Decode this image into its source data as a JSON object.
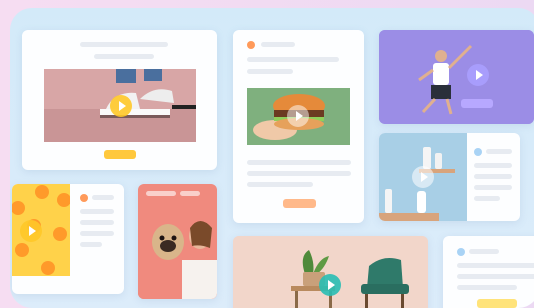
{
  "colors": {
    "page_background": "#f3dcf2",
    "board_background": "#d6ebf9",
    "card_background": "#fdfeff",
    "placeholder_bar": "#e7ebf1",
    "yellow_button": "#ffc83d",
    "peach_button": "#ffb98a",
    "lavender_button": "#b7a8ff",
    "orange_dot": "#ff9a5a",
    "blue_dot": "#a9d3f5"
  },
  "cards": [
    {
      "name": "sneakers-card",
      "image": "sneakers-photo",
      "play_icon": "play-icon"
    },
    {
      "name": "burger-card",
      "image": "burger-photo",
      "play_icon": "play-icon"
    },
    {
      "name": "jumping-man-card",
      "image": "jumping-man-photo",
      "play_icon": "play-icon"
    },
    {
      "name": "skincare-card",
      "image": "skincare-bottles-photo",
      "play_icon": "play-icon"
    },
    {
      "name": "oranges-card",
      "image": "oranges-photo",
      "play_icon": "play-icon"
    },
    {
      "name": "pug-card",
      "image": "woman-with-pug-photo"
    },
    {
      "name": "furniture-card",
      "image": "armchair-and-plant-photo",
      "play_icon": "play-icon"
    },
    {
      "name": "partial-card"
    }
  ]
}
